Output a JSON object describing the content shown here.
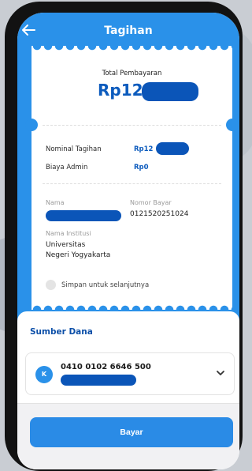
{
  "header": {
    "title": "Tagihan"
  },
  "receipt": {
    "total_label": "Total Pembayaran",
    "total_amount_visible": "Rp12.",
    "rows": [
      {
        "label": "Nominal Tagihan",
        "value": "Rp12"
      },
      {
        "label": "Biaya Admin",
        "value": "Rp0"
      }
    ],
    "nama_label": "Nama",
    "nomor_label": "Nomor Bayar",
    "nomor_value": "0121520251024",
    "institusi_label": "Nama Institusi",
    "institusi_line1": "Universitas",
    "institusi_line2": "Negeri Yogyakarta",
    "save_label": "Simpan untuk selanjutnya"
  },
  "sumber": {
    "title": "Sumber Dana",
    "avatar_letter": "K",
    "account_number": "0410 0102 6646 500"
  },
  "footer": {
    "pay_label": "Bayar"
  },
  "colors": {
    "primary": "#2a91e9",
    "accent": "#0c5bbd",
    "redact": "#0b55b8"
  },
  "icons": {
    "back": "back-arrow-icon",
    "dropdown": "chevron-down-icon"
  }
}
